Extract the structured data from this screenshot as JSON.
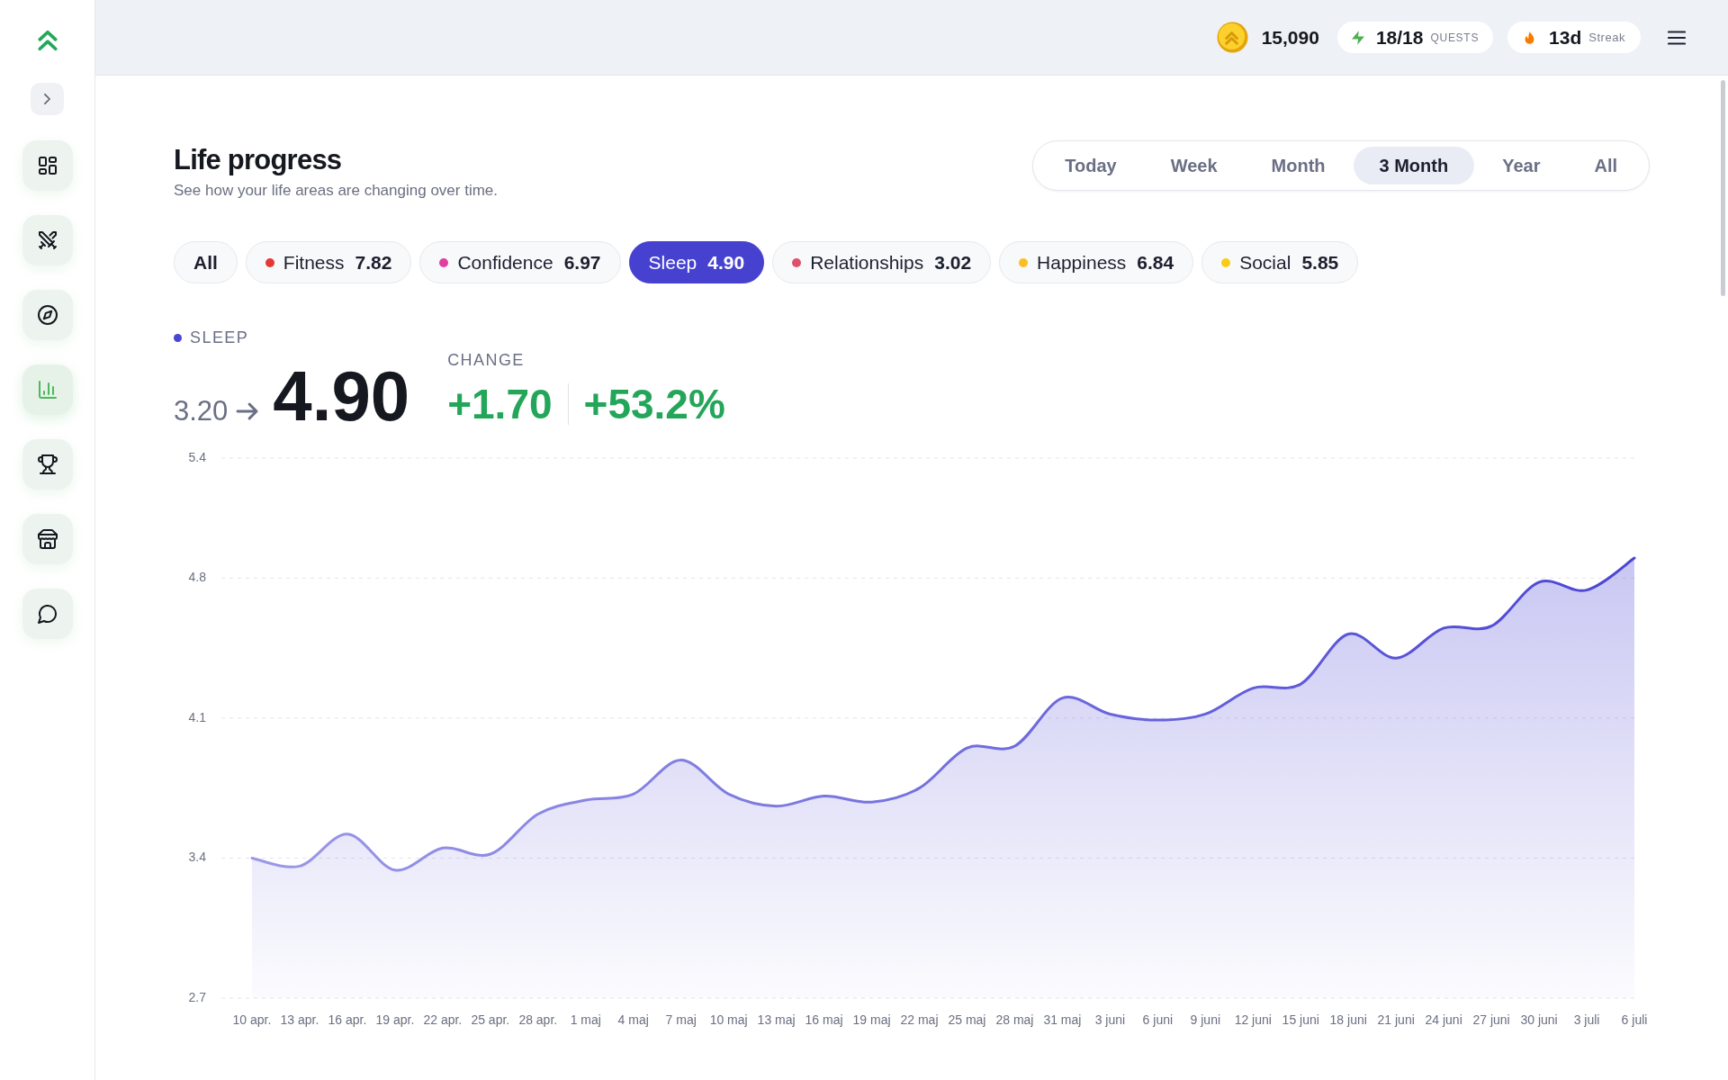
{
  "sidebar": {
    "items": [
      {
        "selected": false
      },
      {
        "selected": false
      },
      {
        "selected": false
      },
      {
        "selected": true
      },
      {
        "selected": false
      },
      {
        "selected": false
      },
      {
        "selected": false
      }
    ]
  },
  "top_bar": {
    "coins": "15,090",
    "quests": {
      "count": "18/18",
      "label": "QUESTS"
    },
    "streak": {
      "count": "13d",
      "label": "Streak"
    }
  },
  "header": {
    "title": "Life progress",
    "subtitle": "See how your life areas are changing over time."
  },
  "periods": [
    {
      "label": "Today",
      "selected": false
    },
    {
      "label": "Week",
      "selected": false
    },
    {
      "label": "Month",
      "selected": false
    },
    {
      "label": "3 Month",
      "selected": true
    },
    {
      "label": "Year",
      "selected": false
    },
    {
      "label": "All",
      "selected": false
    }
  ],
  "areas": [
    {
      "label": "All",
      "selected": false
    },
    {
      "label": "Fitness",
      "value": "7.82",
      "color": "#e53935",
      "selected": false
    },
    {
      "label": "Confidence",
      "value": "6.97",
      "color": "#e0409f",
      "selected": false
    },
    {
      "label": "Sleep",
      "value": "4.90",
      "color": "#4b45d4",
      "selected": true
    },
    {
      "label": "Relationships",
      "value": "3.02",
      "color": "#e0506e",
      "selected": false
    },
    {
      "label": "Happiness",
      "value": "6.84",
      "color": "#fbbf24",
      "selected": false
    },
    {
      "label": "Social",
      "value": "5.85",
      "color": "#facc15",
      "selected": false
    }
  ],
  "summary": {
    "label": "SLEEP",
    "start": "3.20",
    "current": "4.90",
    "change_label": "CHANGE",
    "change": "+1.70",
    "change_percent": "+53.2%"
  },
  "chart": {
    "chart_data": {
      "type": "area",
      "categories": [
        "10 apr.",
        "13 apr.",
        "16 apr.",
        "19 apr.",
        "22 apr.",
        "25 apr.",
        "28 apr.",
        "1 maj",
        "4 maj",
        "7 maj",
        "10 maj",
        "13 maj",
        "16 maj",
        "19 maj",
        "22 maj",
        "25 maj",
        "28 maj",
        "31 maj",
        "3 juni",
        "6 juni",
        "9 juni",
        "12 juni",
        "15 juni",
        "18 juni",
        "21 juni",
        "24 juni",
        "27 juni",
        "30 juni",
        "3 juli",
        "6 juli"
      ],
      "ylim": [
        2.7,
        5.4
      ],
      "yticks": [
        2.7,
        3.4,
        4.1,
        4.8,
        5.4
      ],
      "grid": true,
      "series": [
        {
          "color": "#4b45d4",
          "values": [
            3.4,
            3.36,
            3.52,
            3.34,
            3.45,
            3.42,
            3.62,
            3.69,
            3.72,
            3.89,
            3.72,
            3.66,
            3.71,
            3.68,
            3.75,
            3.95,
            3.96,
            4.2,
            4.12,
            4.09,
            4.12,
            4.25,
            4.27,
            4.52,
            4.4,
            4.55,
            4.56,
            4.78,
            4.74,
            4.9
          ]
        }
      ]
    }
  }
}
